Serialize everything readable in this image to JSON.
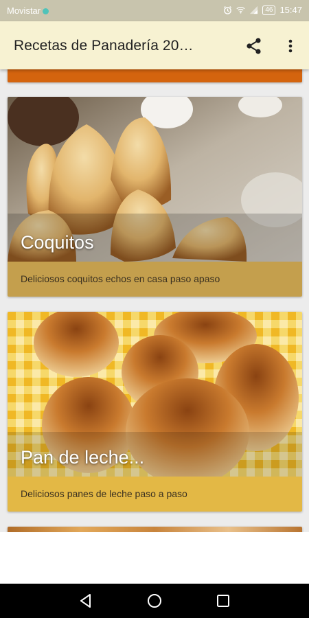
{
  "status_bar": {
    "carrier": "Movistar",
    "battery": "46",
    "time": "15:47"
  },
  "app_bar": {
    "title": "Recetas de Panadería 20…",
    "actions": [
      "share-icon",
      "more-vert-icon"
    ]
  },
  "recipes": [
    {
      "title": "Coquitos",
      "description": "Deliciosos coquitos echos en casa paso apaso"
    },
    {
      "title": "Pan de leche...",
      "description": "Deliciosos panes de leche paso a paso"
    }
  ],
  "nav_bar": {
    "buttons": [
      "back-icon",
      "home-icon",
      "recents-icon"
    ]
  },
  "colors": {
    "status_bar": "#c8c4ad",
    "app_bar": "#f7f2d2",
    "card_top_partial": "#d4640e",
    "card1_footer": "#c49f4d",
    "card2_footer": "#e3b845"
  }
}
